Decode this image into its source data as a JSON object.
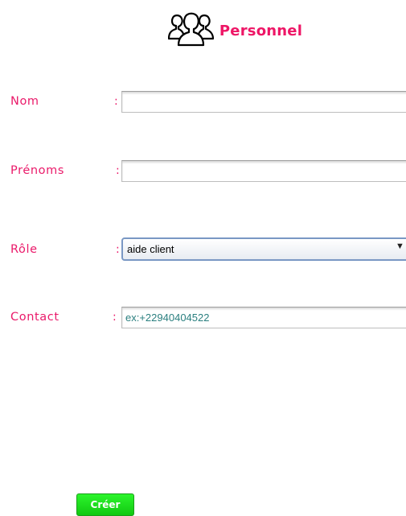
{
  "header": {
    "title": "Personnel",
    "icon": "people-group-icon",
    "title_color": "#ee1666"
  },
  "form": {
    "colon": ":",
    "nom": {
      "label": "Nom",
      "value": ""
    },
    "prenoms": {
      "label": "Prénoms",
      "value": ""
    },
    "role": {
      "label": "Rôle",
      "selected": "aide client"
    },
    "contact": {
      "label": "Contact",
      "placeholder": "ex:+22940404522"
    },
    "label_color": "#ea1a6a"
  },
  "actions": {
    "create_label": "Créer",
    "create_color": "#11c811"
  }
}
